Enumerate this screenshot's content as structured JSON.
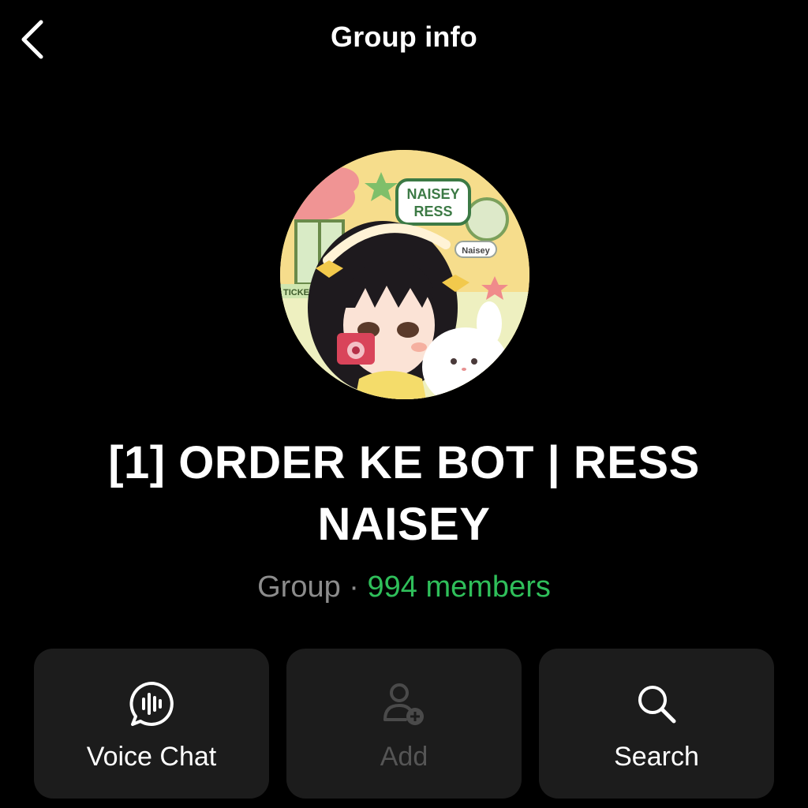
{
  "header": {
    "title": "Group info",
    "back_icon": "chevron-left-icon"
  },
  "group": {
    "avatar_text": {
      "logo_line1": "NAISEY",
      "logo_line2": "RESS",
      "bubble": "Naisey",
      "sign": "TICKE"
    },
    "name": "[1] ORDER KE BOT | RESS NAISEY",
    "type_label": "Group",
    "separator": " · ",
    "members_label": "994 members"
  },
  "actions": [
    {
      "label": "Voice Chat",
      "icon": "voice-chat-icon",
      "enabled": true
    },
    {
      "label": "Add",
      "icon": "add-member-icon",
      "enabled": false
    },
    {
      "label": "Search",
      "icon": "search-icon",
      "enabled": true
    }
  ],
  "colors": {
    "background": "#000000",
    "card": "#1c1c1c",
    "accent_green": "#2fbf5a",
    "muted_text": "#8c8c8c",
    "disabled_text": "#555555"
  }
}
